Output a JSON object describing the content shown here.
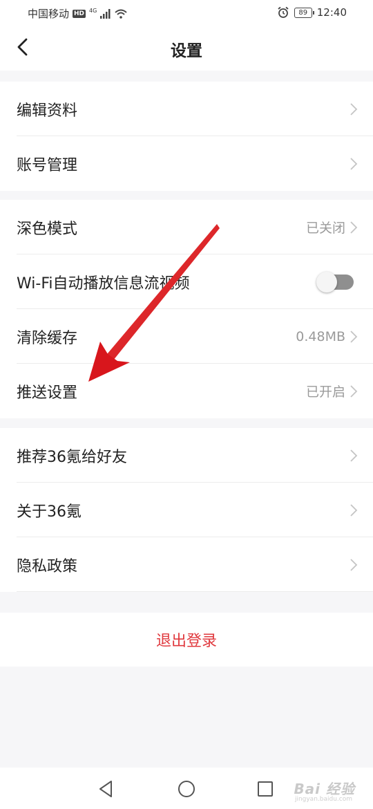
{
  "status_bar": {
    "carrier": "中国移动",
    "hd": "HD",
    "network": "4G",
    "battery": "89",
    "time": "12:40",
    "icons": [
      "signal-icon",
      "wifi-icon",
      "alarm-icon",
      "battery-icon"
    ]
  },
  "header": {
    "title": "设置",
    "back_icon": "chevron-left-icon"
  },
  "group1": {
    "items": [
      {
        "label": "编辑资料"
      },
      {
        "label": "账号管理"
      }
    ]
  },
  "group2": {
    "items": [
      {
        "label": "深色模式",
        "value": "已关闭"
      },
      {
        "label": "Wi-Fi自动播放信息流视频",
        "toggle": false
      },
      {
        "label": "清除缓存",
        "value": "0.48MB"
      },
      {
        "label": "推送设置",
        "value": "已开启"
      }
    ]
  },
  "group3": {
    "items": [
      {
        "label": "推荐36氪给好友"
      },
      {
        "label": "关于36氪"
      },
      {
        "label": "隐私政策"
      }
    ]
  },
  "logout": {
    "label": "退出登录"
  },
  "nav_bar": {
    "icons": [
      "back-triangle-icon",
      "home-circle-icon",
      "recents-square-icon"
    ]
  },
  "watermark": {
    "text": "Bai 经验",
    "sub": "jingyan.baidu.com"
  },
  "colors": {
    "accent": "#e0393e",
    "annotation_arrow": "#e11c1c",
    "background": "#f6f6f8",
    "secondary_text": "#9a9a9a"
  }
}
